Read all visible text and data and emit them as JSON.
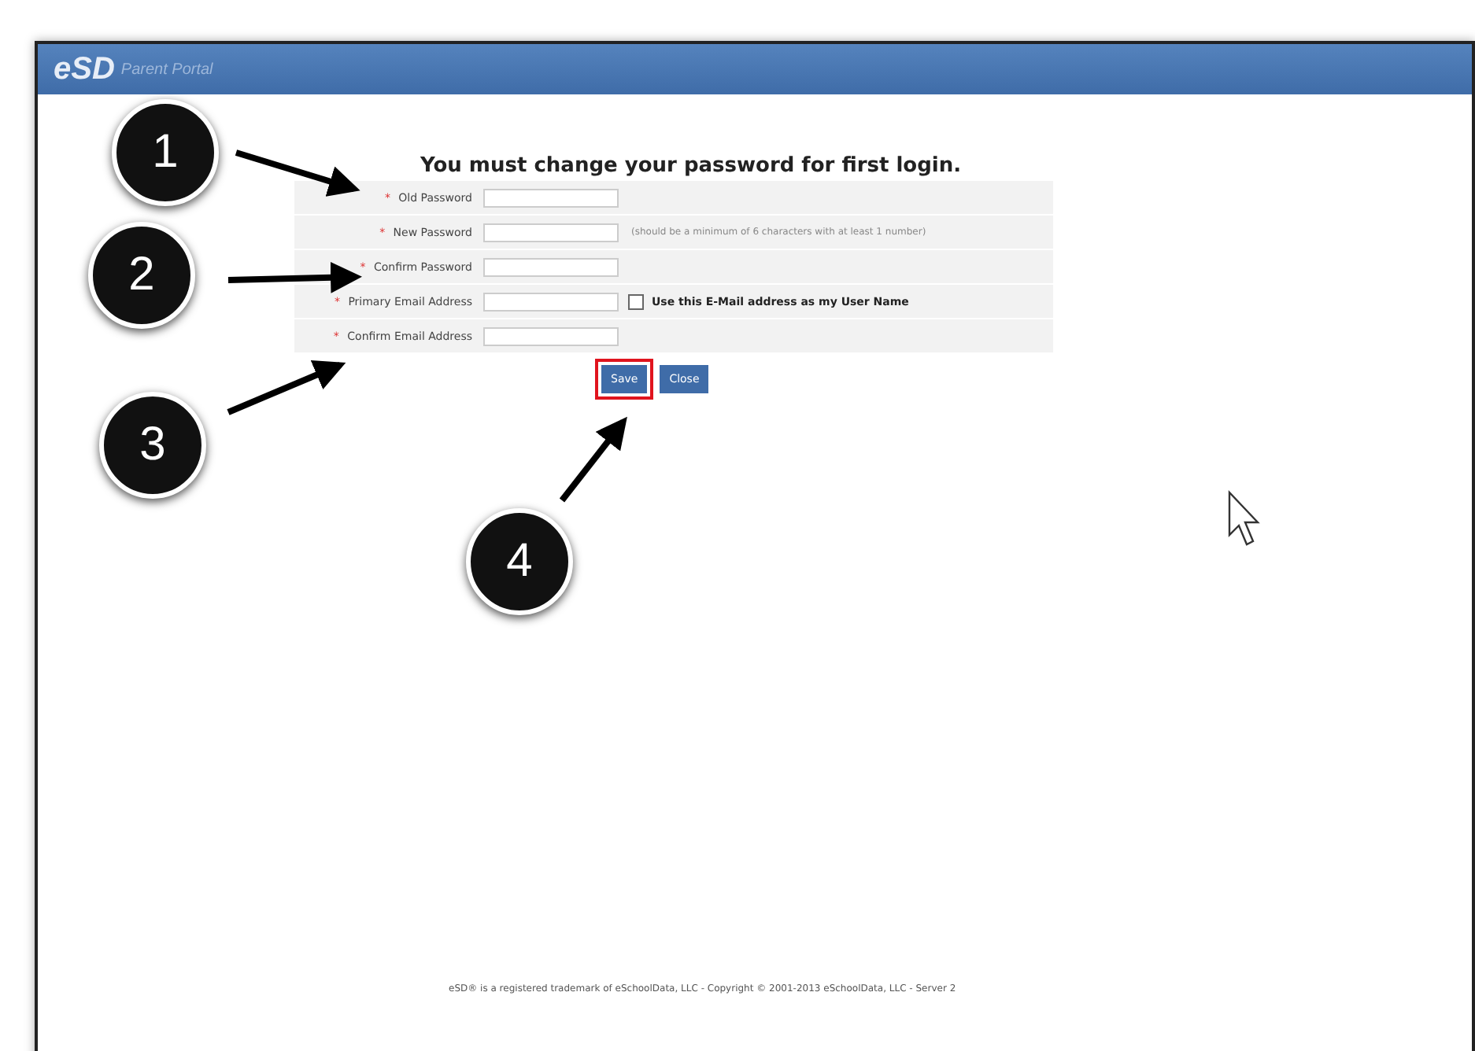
{
  "header": {
    "logo": "eSD",
    "subtitle": "Parent Portal"
  },
  "title": "You must change your password for first login.",
  "fields": [
    {
      "label": "Old Password",
      "required_mark": "*"
    },
    {
      "label": "New Password",
      "required_mark": "*",
      "hint": "(should be a minimum of 6 characters with at least 1 number)"
    },
    {
      "label": "Confirm Password",
      "required_mark": "*"
    },
    {
      "label": "Primary Email Address",
      "required_mark": "*",
      "checkbox": {
        "label": "Use this E-Mail address as my User Name",
        "checked": false
      }
    },
    {
      "label": "Confirm Email Address",
      "required_mark": "*"
    }
  ],
  "buttons": [
    {
      "label": "Save",
      "highlighted": true
    },
    {
      "label": "Close",
      "highlighted": false
    }
  ],
  "footer": "eSD® is a registered trademark of eSchoolData, LLC - Copyright © 2001-2013 eSchoolData, LLC - Server 2",
  "callouts": [
    "1",
    "2",
    "3",
    "4"
  ]
}
